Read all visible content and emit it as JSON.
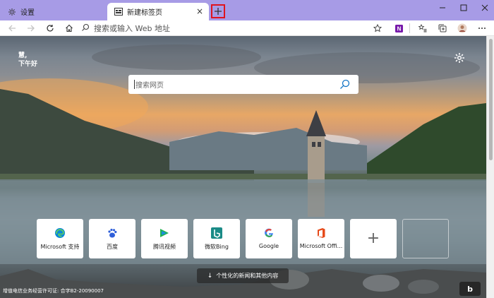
{
  "tabs": [
    {
      "label": "设置",
      "icon": "gear-icon",
      "active": false
    },
    {
      "label": "新建标签页",
      "icon": "newtab-page-icon",
      "active": true
    }
  ],
  "window_controls": [
    "minimize-icon",
    "maximize-icon",
    "close-icon"
  ],
  "address_bar": {
    "placeholder": "搜索或输入 Web 地址"
  },
  "page": {
    "greeting_line1": "慧,",
    "greeting_line2": "下午好",
    "search_placeholder": "搜索网页",
    "quick_links": [
      {
        "label": "Microsoft 支持",
        "icon": "edge-icon",
        "color": "#0c88d8"
      },
      {
        "label": "百度",
        "icon": "baidu-paw-icon",
        "color": "#2f5fd9"
      },
      {
        "label": "腾讯视频",
        "icon": "tencent-video-icon",
        "color": "#20b14f"
      },
      {
        "label": "微软Bing",
        "icon": "bing-icon",
        "color": "#1b8b87"
      },
      {
        "label": "Google",
        "icon": "google-icon",
        "color": "#4285f4"
      },
      {
        "label": "Microsoft Offi...",
        "icon": "office-icon",
        "color": "#e64a19"
      }
    ],
    "add_tile_label": "+",
    "news_button": "个性化的新闻和其他内容",
    "news_arrow": "↓",
    "footer": "增值电信业务经营许可证: 合字B2-20090007",
    "bing_button": "b"
  },
  "colors": {
    "tabbar_bg": "#a79be6",
    "newtab_highlight": "#e0141e"
  }
}
